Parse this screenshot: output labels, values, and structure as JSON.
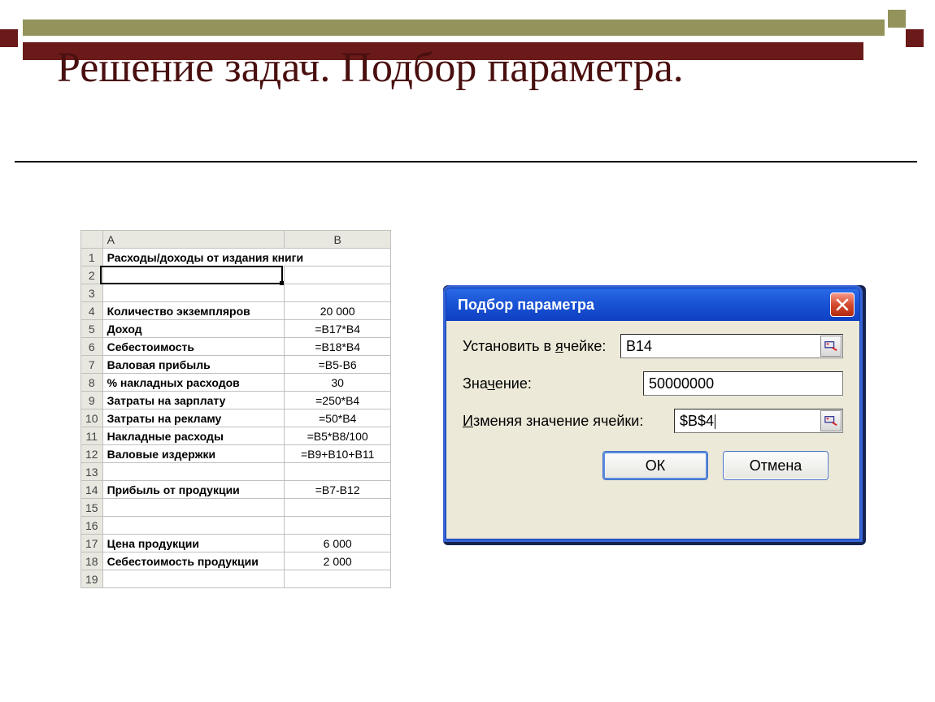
{
  "slide": {
    "title": "Решение задач. Подбор параметра."
  },
  "spreadsheet": {
    "columns": [
      "A",
      "B"
    ],
    "merged_row": {
      "row": 1,
      "text": "Расходы/доходы от издания книги"
    },
    "rows": [
      {
        "row": 2,
        "a": "",
        "b": ""
      },
      {
        "row": 3,
        "a": "",
        "b": ""
      },
      {
        "row": 4,
        "a": "Количество экземпляров",
        "b": "20 000"
      },
      {
        "row": 5,
        "a": "Доход",
        "b": "=B17*B4"
      },
      {
        "row": 6,
        "a": "Себестоимость",
        "b": "=B18*B4"
      },
      {
        "row": 7,
        "a": "Валовая прибыль",
        "b": "=B5-B6"
      },
      {
        "row": 8,
        "a": "% накладных расходов",
        "b": "30"
      },
      {
        "row": 9,
        "a": "Затраты на зарплату",
        "b": "=250*B4"
      },
      {
        "row": 10,
        "a": "Затраты на рекламу",
        "b": "=50*B4"
      },
      {
        "row": 11,
        "a": "Накладные расходы",
        "b": "=B5*B8/100"
      },
      {
        "row": 12,
        "a": "Валовые издержки",
        "b": "=B9+B10+B11"
      },
      {
        "row": 13,
        "a": "",
        "b": ""
      },
      {
        "row": 14,
        "a": "Прибыль от продукции",
        "b": "=B7-B12"
      },
      {
        "row": 15,
        "a": "",
        "b": ""
      },
      {
        "row": 16,
        "a": "",
        "b": ""
      },
      {
        "row": 17,
        "a": "Цена продукции",
        "b": "6 000"
      },
      {
        "row": 18,
        "a": "Себестоимость продукции",
        "b": "2 000"
      },
      {
        "row": 19,
        "a": "",
        "b": ""
      }
    ]
  },
  "dialog": {
    "title": "Подбор параметра",
    "labels": {
      "set_cell_pre": "Установить в ",
      "set_cell_mn": "я",
      "set_cell_post": "чейке:",
      "value_pre": "Зна",
      "value_mn": "ч",
      "value_post": "ение:",
      "change_pre": "",
      "change_mn": "И",
      "change_post": "зменяя значение ячейки:"
    },
    "values": {
      "set_cell": "B14",
      "value": "50000000",
      "changing_cell": "$B$4"
    },
    "buttons": {
      "ok": "ОК",
      "cancel": "Отмена"
    }
  }
}
